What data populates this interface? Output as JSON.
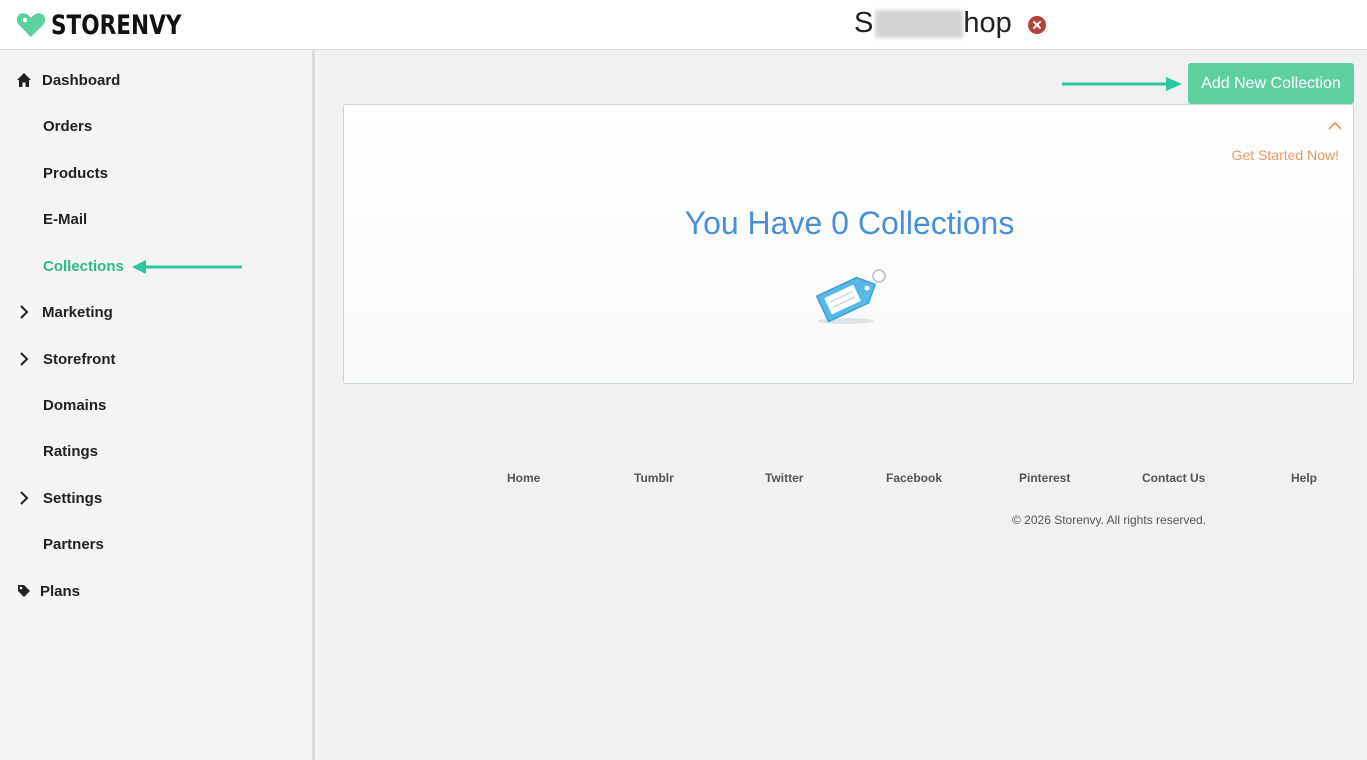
{
  "header": {
    "logo_text": "STORENVY",
    "shop_title_start": "S",
    "shop_title_end": "hop"
  },
  "sidebar": {
    "items": [
      {
        "label": "Dashboard",
        "icon": "home-icon"
      },
      {
        "label": "Orders"
      },
      {
        "label": "Products"
      },
      {
        "label": "E-Mail"
      },
      {
        "label": "Collections",
        "active": true
      },
      {
        "label": "Marketing",
        "icon": "chevron-right-icon"
      },
      {
        "label": "Storefront",
        "icon": "chevron-right-icon"
      },
      {
        "label": "Domains"
      },
      {
        "label": "Ratings"
      },
      {
        "label": "Settings",
        "icon": "chevron-right-icon"
      },
      {
        "label": "Partners"
      },
      {
        "label": "Plans",
        "icon": "tag-icon"
      }
    ]
  },
  "main": {
    "add_button_label": "Add New Collection",
    "get_started_label": "Get Started Now!",
    "empty_title": "You Have 0 Collections"
  },
  "footer": {
    "links": [
      "Home",
      "Tumblr",
      "Twitter",
      "Facebook",
      "Pinterest",
      "Contact Us",
      "Help"
    ],
    "copyright": "© 2026 Storenvy. All rights reserved."
  },
  "colors": {
    "brand_green": "#5ecf9f",
    "active_green": "#2cb98a",
    "title_blue": "#4a90d9",
    "accent_orange": "#e89a62",
    "close_red": "#b4433c"
  }
}
